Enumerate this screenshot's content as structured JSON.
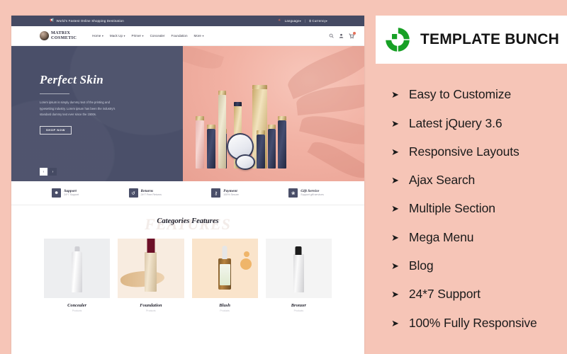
{
  "promo": {
    "brand_name": "TEMPLATE BUNCH",
    "logo_icon": "template-bunch-logo",
    "logo_color": "#17a025",
    "bg_color": "#f6c5b7",
    "bullet_icon": "triangle-right-icon",
    "features": [
      "Easy to Customize",
      "Latest jQuery 3.6",
      "Responsive Layouts",
      "Ajax Search",
      "Multiple Section",
      "Mega Menu",
      "Blog",
      "24*7 Support",
      "100% Fully Responsive"
    ]
  },
  "site": {
    "topbar": {
      "announcement_icon": "megaphone-icon",
      "announcement": "World's Fastest Online Shopping Destination",
      "globe_icon": "globe-icon",
      "language_label": "Language",
      "separator": "|",
      "currency_symbol": "$",
      "currency_label": "Currency",
      "caret": "▾",
      "bg_color": "#454a63",
      "accent_color": "#e4705a"
    },
    "header": {
      "logo_icon": "matrix-cosmetic-logo",
      "brand_line1": "MATRIX",
      "brand_line2": "COSMETIC",
      "nav": [
        {
          "label": "Home",
          "has_dropdown": true
        },
        {
          "label": "Mack Up",
          "has_dropdown": true
        },
        {
          "label": "Primer",
          "has_dropdown": true
        },
        {
          "label": "Concealer",
          "has_dropdown": false
        },
        {
          "label": "Foundation",
          "has_dropdown": false
        },
        {
          "label": "More",
          "has_dropdown": true
        }
      ],
      "caret": "▾",
      "icons": [
        "search-icon",
        "user-account-icon",
        "shopping-cart-icon"
      ]
    },
    "hero": {
      "title": "Perfect Skin",
      "body": "Lorem ipsum is simply dummy text of the printing and typesetting industry. Lorem ipsum has been the industry's standard dummy text ever since the 1500s.",
      "cta": "SHOP NOW",
      "prev_arrow": "‹",
      "next_arrow": "›",
      "bg_left_color": "#4a4f69",
      "bg_right_color": "#f2b2a4"
    },
    "services": [
      {
        "icon": "headset-support-icon",
        "glyph": "☺",
        "title": "Support",
        "subtitle": "24*7 Support"
      },
      {
        "icon": "returns-arrows-icon",
        "glyph": "↺",
        "title": "Returns",
        "subtitle": "24*7 Free Returns"
      },
      {
        "icon": "payment-lock-icon",
        "glyph": "⚿",
        "title": "Payment",
        "subtitle": "100% Secure"
      },
      {
        "icon": "gift-box-icon",
        "glyph": "❀",
        "title": "Gift Service",
        "subtitle": "Support gift services"
      }
    ],
    "categories": {
      "heading": "Categories Features",
      "watermark": "FEATURES",
      "items": [
        {
          "name": "Concealer",
          "subtitle": "Products",
          "thumb_color": "#edeef0"
        },
        {
          "name": "Foundation",
          "subtitle": "Products",
          "thumb_color": "#f8ece0"
        },
        {
          "name": "Blush",
          "subtitle": "Products",
          "thumb_color": "#fae4cb"
        },
        {
          "name": "Bronzer",
          "subtitle": "Products",
          "thumb_color": "#f4f4f4"
        }
      ]
    }
  }
}
